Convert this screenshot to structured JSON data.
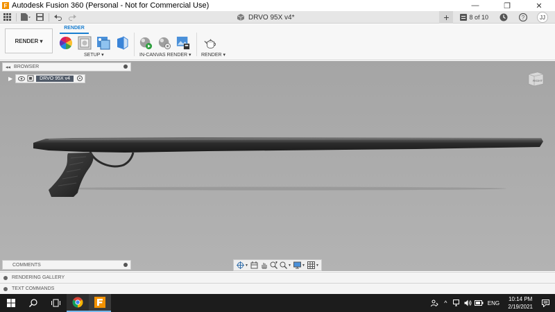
{
  "window": {
    "title": "Autodesk Fusion 360 (Personal - Not for Commercial Use)",
    "controls": [
      "—",
      "❐",
      "✕"
    ]
  },
  "tabbar": {
    "document_title": "DRVO 95X v4*",
    "job_status": "8 of 10",
    "user_initials": "JJ"
  },
  "ribbon": {
    "workspace_label": "RENDER ▾",
    "active_tab": "RENDER",
    "groups": {
      "setup": "SETUP ▾",
      "in_canvas_render": "IN-CANVAS RENDER ▾",
      "render": "RENDER ▾"
    }
  },
  "browser": {
    "title": "BROWSER",
    "root_node": "DRVO 95X v4"
  },
  "viewcube": {
    "face": "RIGHT"
  },
  "comments": {
    "title": "COMMENTS"
  },
  "panels": {
    "rendering_gallery": "RENDERING GALLERY",
    "text_commands": "TEXT COMMANDS"
  },
  "taskbar": {
    "language": "ENG",
    "time": "10:14 PM",
    "date": "2/19/2021"
  },
  "colors": {
    "accent": "#1a7fd0",
    "viewport_top": "#a5a5a5",
    "viewport_bottom": "#b3b3b3",
    "taskbar": "#1c1c1c",
    "fusion_orange": "#f29100"
  },
  "icons": [
    "grid-icon",
    "file-icon",
    "save-icon",
    "undo-icon",
    "redo-icon",
    "close-icon",
    "plus-icon",
    "job-status-icon",
    "clock-history-icon",
    "help-icon",
    "scene-settings-icon",
    "appearance-icon",
    "texture-map-icon",
    "render-preview-icon",
    "in-canvas-render-icon",
    "capture-image-icon",
    "render-teapot-icon",
    "orbit-icon",
    "look-at-icon",
    "pan-icon",
    "zoom-icon",
    "fit-icon",
    "display-settings-icon",
    "grid-display-icon",
    "windows-start-icon",
    "search-icon",
    "task-view-icon",
    "chrome-icon",
    "fusion-icon",
    "notification-icon"
  ]
}
